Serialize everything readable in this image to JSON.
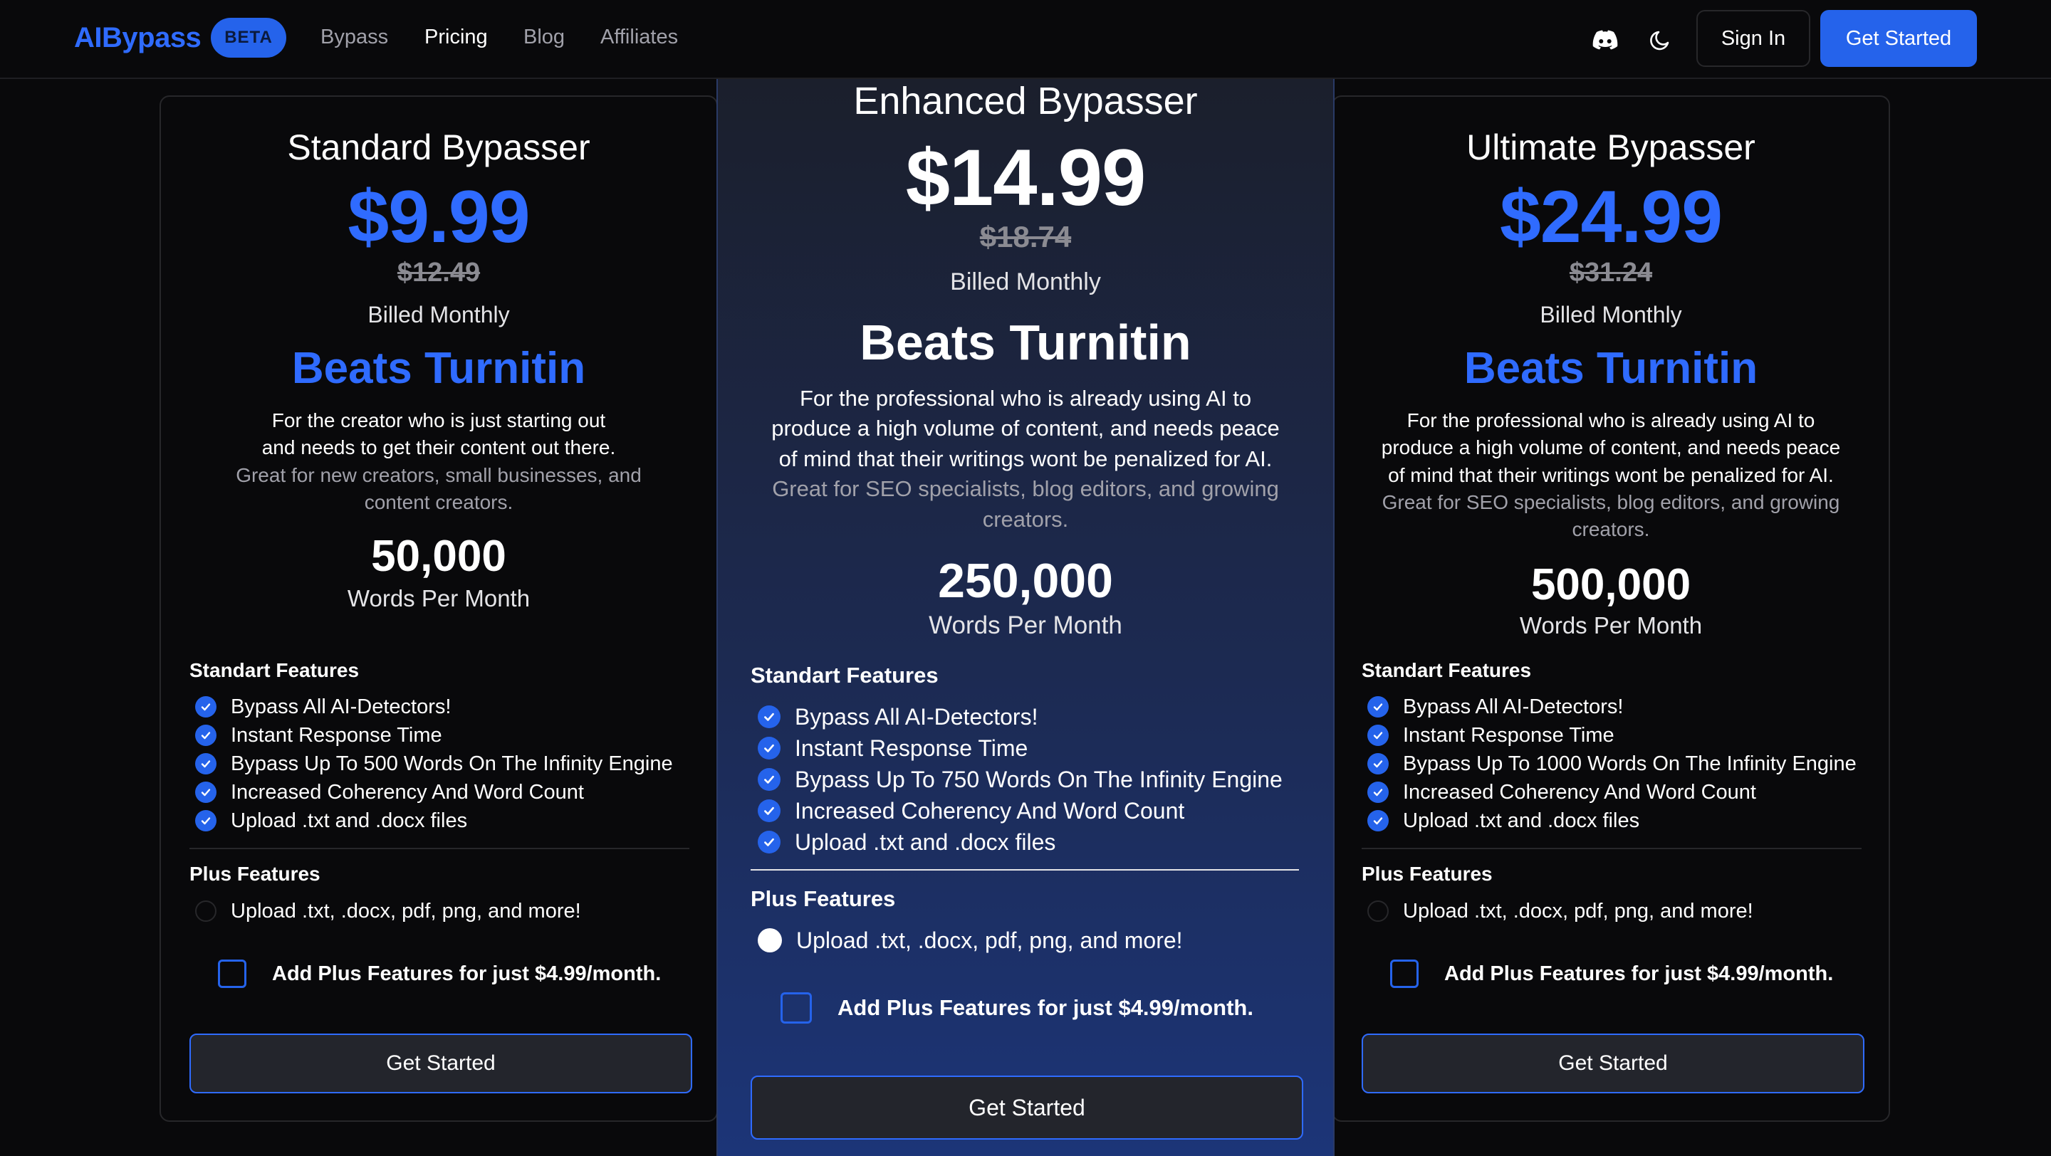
{
  "nav": {
    "brand": "AIBypass",
    "badge": "BETA",
    "links": [
      "Bypass",
      "Pricing",
      "Blog",
      "Affiliates"
    ],
    "active_link": "Pricing",
    "icons": [
      "discord-icon",
      "moon-icon"
    ],
    "sign_in": "Sign In",
    "get_started": "Get Started"
  },
  "colors": {
    "accent": "#2563eb",
    "background": "#09090b",
    "muted_text": "#a1a1aa"
  },
  "plans": [
    {
      "name": "Standard Bypasser",
      "price": "$9.99",
      "old_price": "$12.49",
      "billing": "Billed Monthly",
      "headline": "Beats Turnitin",
      "desc_lines": [
        "For the creator who is just starting out",
        "and needs to get their content out there."
      ],
      "desc_muted": [
        "Great for new creators, small businesses, and",
        "content creators."
      ],
      "words": "50,000",
      "words_label": "Words Per Month",
      "standard_title": "Standart Features",
      "standard_features": [
        "Bypass All AI-Detectors!",
        "Instant Response Time",
        "Bypass Up To 500 Words On The Infinity Engine",
        "Increased Coherency And Word Count",
        "Upload .txt and .docx files"
      ],
      "plus_title": "Plus Features",
      "plus_features": [
        "Upload .txt, .docx, pdf, png, and more!"
      ],
      "addon": "Add Plus Features for just $4.99/month.",
      "cta": "Get Started"
    },
    {
      "name": "Enhanced Bypasser",
      "price": "$14.99",
      "old_price": "$18.74",
      "billing": "Billed Monthly",
      "headline": "Beats Turnitin",
      "desc_lines": [
        "For the professional who is already using AI to",
        "produce a high volume of content, and needs peace",
        "of mind that their writings wont be penalized for AI."
      ],
      "desc_muted": [
        "Great for SEO specialists, blog editors, and growing",
        "creators."
      ],
      "words": "250,000",
      "words_label": "Words Per Month",
      "standard_title": "Standart Features",
      "standard_features": [
        "Bypass All AI-Detectors!",
        "Instant Response Time",
        "Bypass Up To 750 Words On The Infinity Engine",
        "Increased Coherency And Word Count",
        "Upload .txt and .docx files"
      ],
      "plus_title": "Plus Features",
      "plus_features": [
        "Upload .txt, .docx, pdf, png, and more!"
      ],
      "addon": "Add Plus Features for just $4.99/month.",
      "cta": "Get Started"
    },
    {
      "name": "Ultimate Bypasser",
      "price": "$24.99",
      "old_price": "$31.24",
      "billing": "Billed Monthly",
      "headline": "Beats Turnitin",
      "desc_lines": [
        "For the professional who is already using AI to",
        "produce a high volume of content, and needs peace",
        "of mind that their writings wont be penalized for AI."
      ],
      "desc_muted": [
        "Great for SEO specialists, blog editors, and growing",
        "creators."
      ],
      "words": "500,000",
      "words_label": "Words Per Month",
      "standard_title": "Standart Features",
      "standard_features": [
        "Bypass All AI-Detectors!",
        "Instant Response Time",
        "Bypass Up To 1000 Words On The Infinity Engine",
        "Increased Coherency And Word Count",
        "Upload .txt and .docx files"
      ],
      "plus_title": "Plus Features",
      "plus_features": [
        "Upload .txt, .docx, pdf, png, and more!"
      ],
      "addon": "Add Plus Features for just $4.99/month.",
      "cta": "Get Started"
    }
  ]
}
